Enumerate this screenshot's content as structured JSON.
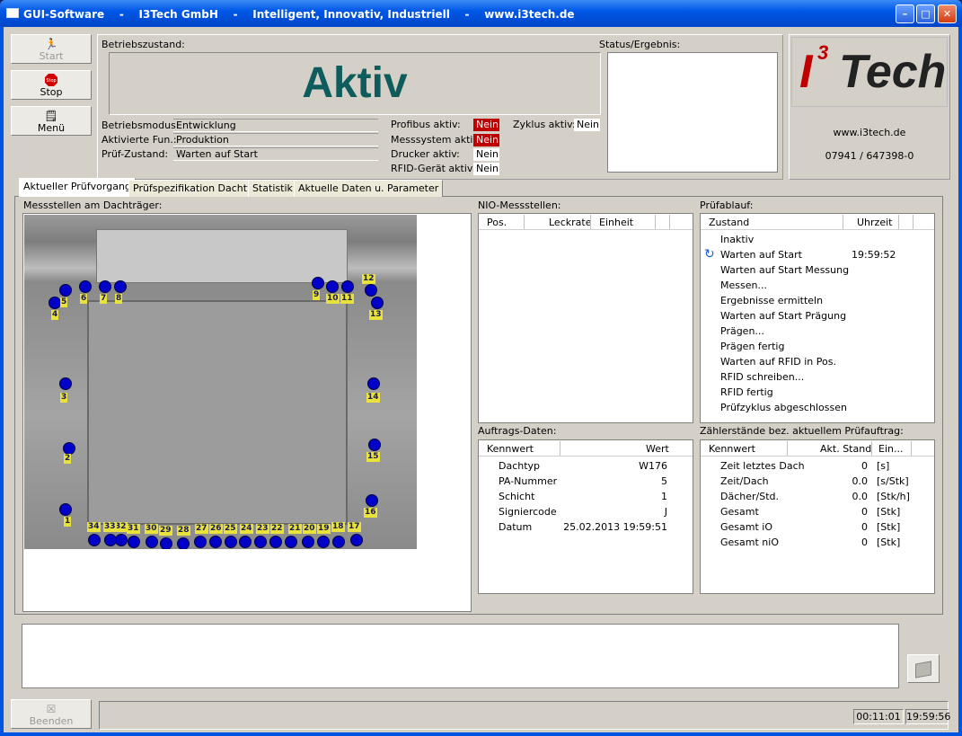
{
  "window": {
    "title": "GUI-Software    -    I3Tech GmbH    -    Intelligent, Innovativ, Industriell    -    www.i3tech.de"
  },
  "buttons": {
    "start": "Start",
    "stop": "Stop",
    "menu": "Menü",
    "beenden": "Beenden",
    "stop_icon_text": "Stop"
  },
  "status": {
    "betriebszustand_label": "Betriebszustand:",
    "betriebszustand_value": "Aktiv",
    "status_ergebnis_label": "Status/Ergebnis:",
    "betriebsmodus_label": "Betriebsmodus:",
    "betriebsmodus_value": "Entwicklung",
    "aktivierte_label": "Aktivierte Fun.:",
    "aktivierte_value": "Produktion",
    "pruef_label": "Prüf-Zustand:",
    "pruef_value": "Warten auf Start",
    "profibus_label": "Profibus aktiv:",
    "profibus_value": "Nein",
    "messsystem_label": "Messsystem aktiv:",
    "messsystem_value": "Nein",
    "drucker_label": "Drucker aktiv:",
    "drucker_value": "Nein",
    "rfid_label": "RFID-Gerät aktiv:",
    "rfid_value": "Nein",
    "zyklus_label": "Zyklus aktiv:",
    "zyklus_value": "Nein"
  },
  "brand": {
    "logo_prefix": "I",
    "logo_sup": "3",
    "logo_suffix": "Tech",
    "website": "www.i3tech.de",
    "phone": "07941 / 647398-0"
  },
  "tabs": [
    "Aktueller Prüfvorgang",
    "Prüfspezifikation Dachtyp",
    "Statistik",
    "Aktuelle Daten u. Parameter"
  ],
  "sections": {
    "messstellen": "Messstellen am Dachträger:",
    "nio": "NIO-Messstellen:",
    "pruefablauf": "Prüfablauf:",
    "auftrag": "Auftrags-Daten:",
    "zaehler": "Zählerstände bez. aktuellem Prüfauftrag:"
  },
  "nio": {
    "headers": [
      "Pos.",
      "Leckrate",
      "Einheit"
    ]
  },
  "pruefablauf": {
    "headers": [
      "Zustand",
      "Uhrzeit"
    ],
    "rows": [
      {
        "state": "Inaktiv",
        "time": ""
      },
      {
        "state": "Warten auf Start",
        "time": "19:59:52"
      },
      {
        "state": "Warten auf Start Messung",
        "time": ""
      },
      {
        "state": "Messen...",
        "time": ""
      },
      {
        "state": "Ergebnisse ermitteln",
        "time": ""
      },
      {
        "state": "Warten auf Start Prägung",
        "time": ""
      },
      {
        "state": "Prägen...",
        "time": ""
      },
      {
        "state": "Prägen fertig",
        "time": ""
      },
      {
        "state": "Warten auf RFID in Pos.",
        "time": ""
      },
      {
        "state": "RFID schreiben...",
        "time": ""
      },
      {
        "state": "RFID fertig",
        "time": ""
      },
      {
        "state": "Prüfzyklus abgeschlossen",
        "time": ""
      }
    ]
  },
  "auftrag": {
    "headers": [
      "Kennwert",
      "Wert"
    ],
    "rows": [
      {
        "key": "Dachtyp",
        "value": "W176"
      },
      {
        "key": "PA-Nummer",
        "value": "5"
      },
      {
        "key": "Schicht",
        "value": "1"
      },
      {
        "key": "Signiercode",
        "value": "J"
      },
      {
        "key": "Datum",
        "value": "25.02.2013 19:59:51"
      }
    ]
  },
  "zaehler": {
    "headers": [
      "Kennwert",
      "Akt. Stand",
      "Ein..."
    ],
    "rows": [
      {
        "key": "Zeit letztes Dach",
        "value": "0",
        "unit": "[s]"
      },
      {
        "key": "Zeit/Dach",
        "value": "0.0",
        "unit": "[s/Stk]"
      },
      {
        "key": "Dächer/Std.",
        "value": "0.0",
        "unit": "[Stk/h]"
      },
      {
        "key": "Gesamt",
        "value": "0",
        "unit": "[Stk]"
      },
      {
        "key": "Gesamt iO",
        "value": "0",
        "unit": "[Stk]"
      },
      {
        "key": "Gesamt niO",
        "value": "0",
        "unit": "[Stk]"
      }
    ]
  },
  "messpunkte": [
    "1",
    "2",
    "3",
    "4",
    "5",
    "6",
    "7",
    "8",
    "9",
    "10",
    "11",
    "12",
    "13",
    "14",
    "15",
    "16",
    "17",
    "18",
    "19",
    "20",
    "21",
    "22",
    "23",
    "24",
    "25",
    "26",
    "27",
    "28",
    "29",
    "30",
    "31",
    "32",
    "33",
    "34"
  ],
  "statusbar": {
    "timer": "00:11:01",
    "clock": "19:59:56"
  }
}
